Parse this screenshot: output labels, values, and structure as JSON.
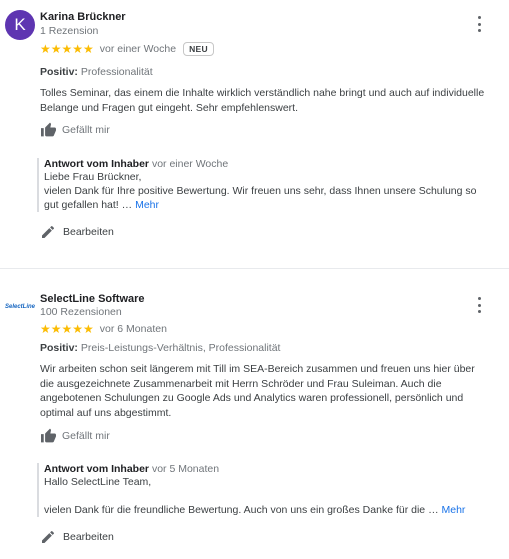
{
  "reviews": [
    {
      "avatar_letter": "K",
      "author": "Karina Brückner",
      "count": "1 Rezension",
      "stars": "★★★★★",
      "time": "vor einer Woche",
      "badge": "NEU",
      "positive_label": "Positiv:",
      "positive_value": "Professionalität",
      "text": "Tolles Seminar, das einem die Inhalte wirklich verständlich nahe bringt und auch auf individuelle Belange und Fragen gut eingeht. Sehr empfehlenswert.",
      "like_label": "Gefällt mir",
      "owner_title": "Antwort vom Inhaber",
      "owner_time": "vor einer Woche",
      "owner_line1": "Liebe Frau Brückner,",
      "owner_line2": "vielen Dank für Ihre positive Bewertung. Wir freuen uns sehr, dass Ihnen unsere Schulung so gut gefallen hat!",
      "ellipsis": "…",
      "more_label": "Mehr",
      "edit_label": "Bearbeiten"
    },
    {
      "avatar_logo_text": "SelectLine",
      "author": "SelectLine Software",
      "count": "100 Rezensionen",
      "stars": "★★★★★",
      "time": "vor 6 Monaten",
      "positive_label": "Positiv:",
      "positive_value": "Preis-Leistungs-Verhältnis, Professionalität",
      "text": "Wir arbeiten schon seit längerem mit Till im SEA-Bereich zusammen und freuen uns hier über die ausgezeichnete Zusammenarbeit mit Herrn Schröder und Frau Suleiman. Auch die angebotenen Schulungen zu Google Ads und Analytics waren professionell, persönlich und optimal auf uns abgestimmt.",
      "like_label": "Gefällt mir",
      "owner_title": "Antwort vom Inhaber",
      "owner_time": "vor 5 Monaten",
      "owner_line1": "Hallo SelectLine Team,",
      "owner_line2": "vielen Dank für die freundliche Bewertung. Auch von uns ein großes Danke für die",
      "ellipsis": "…",
      "more_label": "Mehr",
      "edit_label": "Bearbeiten"
    }
  ],
  "colors": {
    "star": "#fbbc04",
    "link": "#1a73e8",
    "avatar": "#5e35b1"
  },
  "icons": [
    "more-vert-icon",
    "thumb-up-icon",
    "pencil-icon"
  ]
}
